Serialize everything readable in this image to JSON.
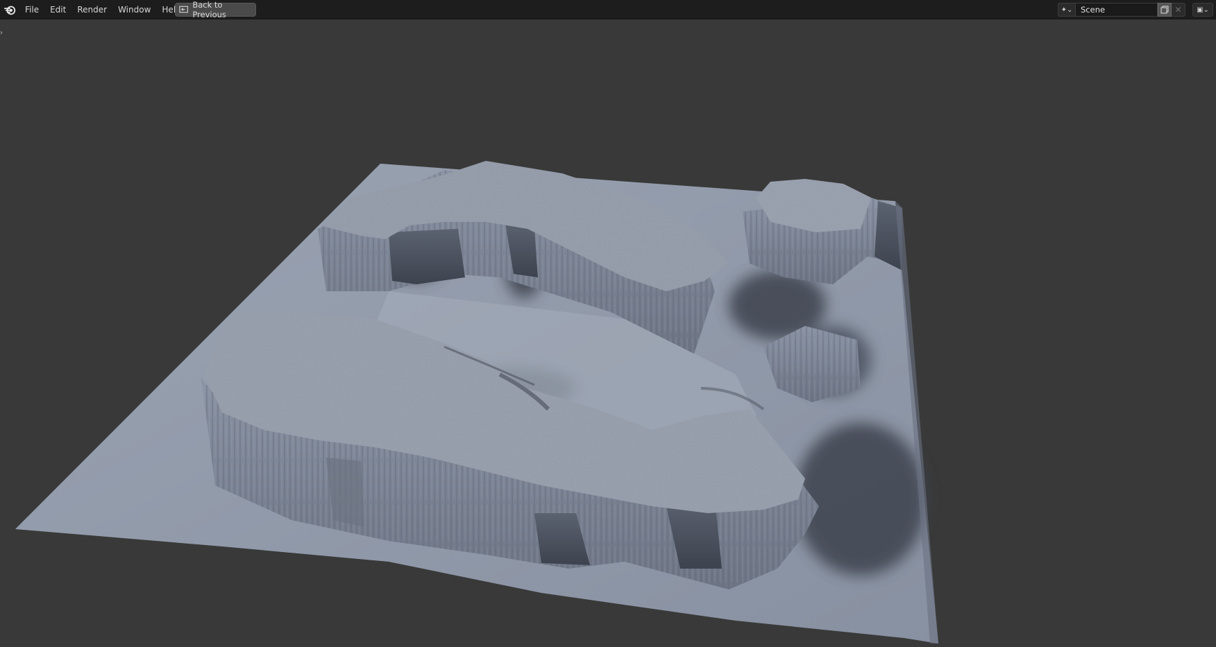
{
  "topbar": {
    "menu": [
      {
        "label": "File"
      },
      {
        "label": "Edit"
      },
      {
        "label": "Render"
      },
      {
        "label": "Window"
      },
      {
        "label": "Help"
      }
    ],
    "back_button_label": "Back to Previous",
    "scene": {
      "name": "Scene",
      "type_icon": "scene-data-icon",
      "new_icon": "duplicate-icon",
      "close_icon": "close-icon"
    },
    "view_layer_icon": "view-layer-icon"
  },
  "viewport": {
    "background_color": "#393939",
    "object": "terrain-mesh",
    "mesh_color": "#8c95a5",
    "shadow_color": "#3e4450"
  }
}
